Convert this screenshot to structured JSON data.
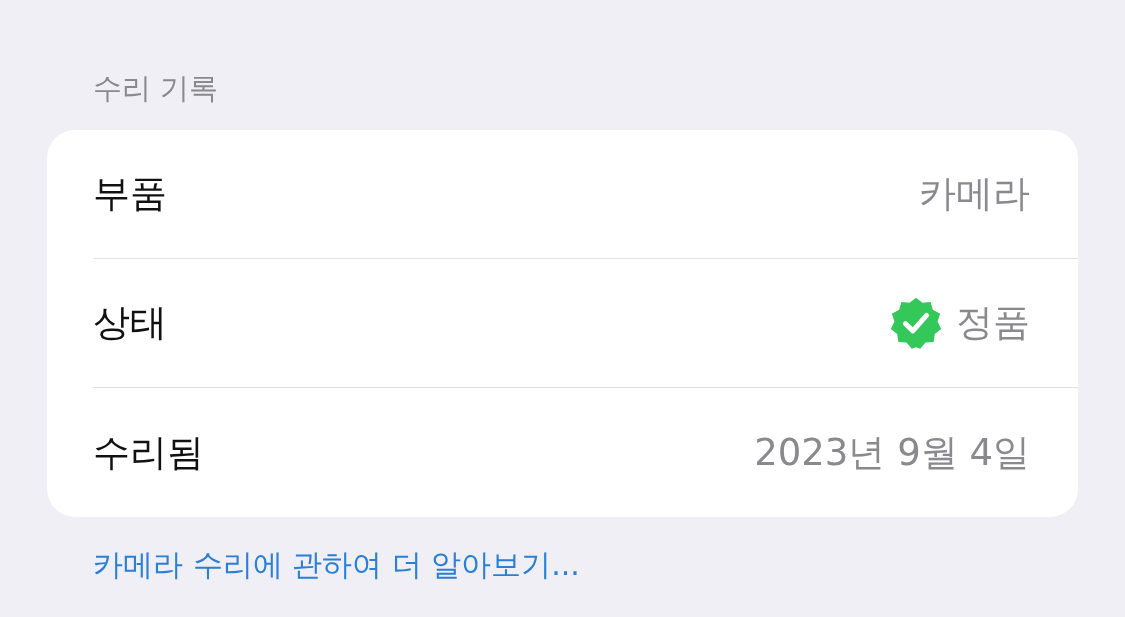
{
  "section_title": "수리 기록",
  "rows": [
    {
      "label": "부품",
      "value": "카메라",
      "kind": "plain"
    },
    {
      "label": "상태",
      "value": "정품",
      "kind": "verified"
    },
    {
      "label": "수리됨",
      "value": "2023년 9월 4일",
      "kind": "plain"
    }
  ],
  "link": "카메라 수리에 관하여 더 알아보기..."
}
